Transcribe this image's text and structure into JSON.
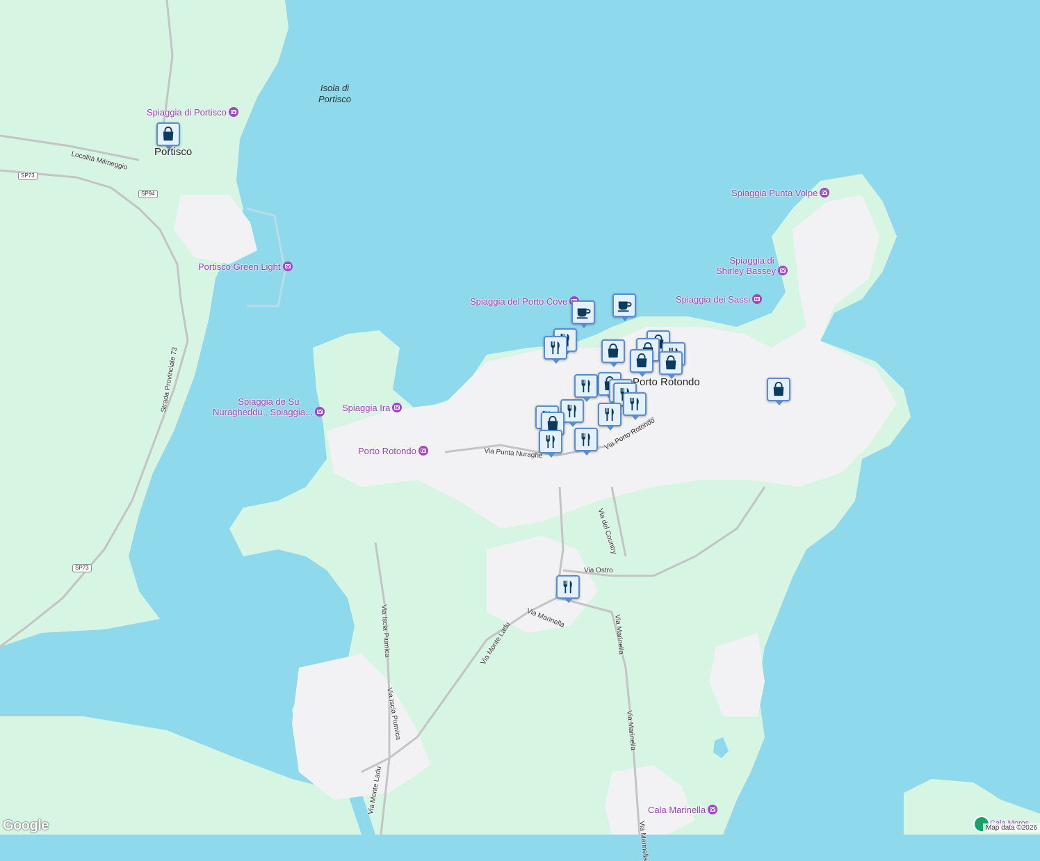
{
  "map": {
    "colors": {
      "water": "#8fd9ec",
      "land": "#d6f5e3",
      "urban": "#f2f2f4",
      "road": "#c4c4c4",
      "poi": "#9b3fb7",
      "marker_border": "#5b8ccb",
      "marker_icon": "#0b3c5d"
    },
    "towns": [
      "Portisco",
      "Porto Rotondo"
    ],
    "island": [
      "Isola di",
      "Portisco"
    ],
    "pois": [
      "Spiaggia di Portisco",
      "Portisco Green Light",
      "Spiaggia del Porto Cove",
      "Spiaggia Punta Volpe",
      "Spiaggia di",
      "Shirley Bassey",
      "Spiaggia dei Sassi",
      "Spiaggia de Su",
      "Nuragheddu , Spiaggia...",
      "Spiaggia Ira",
      "Porto Rotondo",
      "Cala Marinella",
      "Cala Moros"
    ],
    "roads": [
      "Località Milmeggio",
      "Strada Provinciale 73",
      "Via Punta Nuraghe",
      "Via Porto Rotondo",
      "Via del Country",
      "Via Ostro",
      "Via Marinella",
      "Via Monte Ladu",
      "Via Iscia Piumica",
      "Via Iscia Piumica",
      "Via Marinella",
      "Via Marinella",
      "Via Monte Ladu",
      "Via Marinella"
    ],
    "shields": [
      "SP73",
      "SP94",
      "SP73"
    ],
    "markers": {
      "shopping": "shopping-bag-icon",
      "restaurant": "fork-knife-icon",
      "cafe": "coffee-cup-icon"
    },
    "google_logo": "Google",
    "attribution": "Map data ©2026"
  }
}
